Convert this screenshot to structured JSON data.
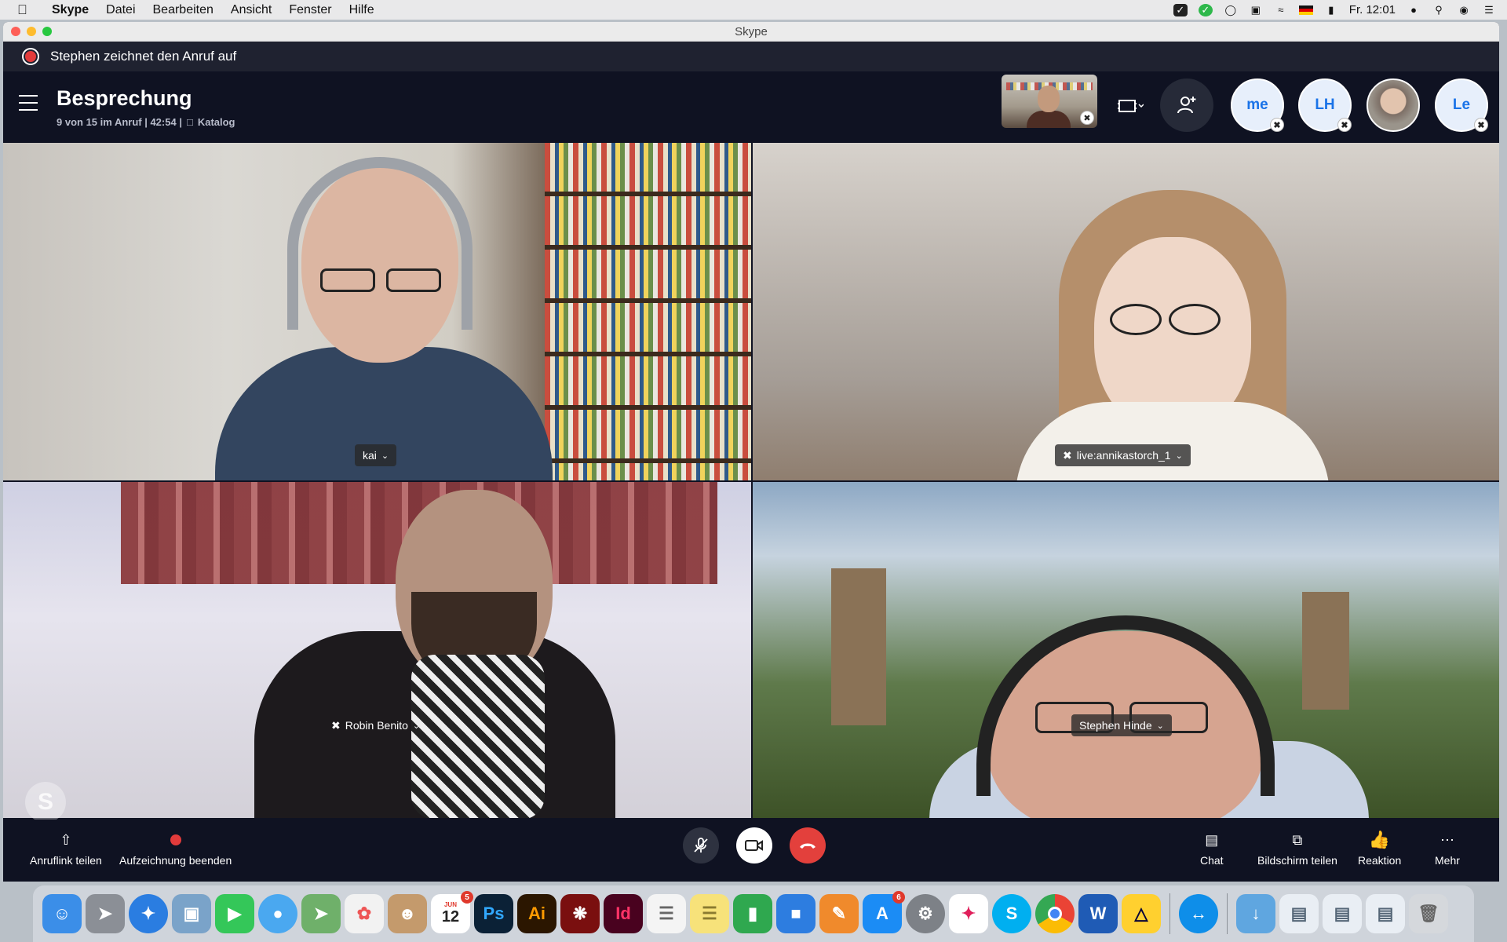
{
  "menubar": {
    "app_name": "Skype",
    "menus": [
      "Datei",
      "Bearbeiten",
      "Ansicht",
      "Fenster",
      "Hilfe"
    ],
    "clock": "Fr. 12:01"
  },
  "window": {
    "title": "Skype"
  },
  "recording_banner": {
    "text": "Stephen zeichnet den Anruf auf",
    "color": "#e23b3b"
  },
  "call_header": {
    "title": "Besprechung",
    "participants_status": "9 von 15 im Anruf | 42:54 |",
    "catalog_label": "Katalog",
    "avatars": [
      {
        "initials": "me"
      },
      {
        "initials": "LH"
      },
      {
        "initials": ""
      },
      {
        "initials": "Le"
      }
    ]
  },
  "participants": [
    {
      "name": "kai",
      "muted": false
    },
    {
      "name": "live:annikastorch_1",
      "muted": true
    },
    {
      "name": "Robin Benito",
      "muted": true
    },
    {
      "name": "Stephen Hinde",
      "muted": false
    }
  ],
  "controls": {
    "share_link": "Anruflink teilen",
    "stop_recording": "Aufzeichnung beenden",
    "chat": "Chat",
    "share_screen": "Bildschirm teilen",
    "reaction": "Reaktion",
    "more": "Mehr",
    "hangup_color": "#e3403c"
  },
  "dock": {
    "calendar_month": "JUN",
    "calendar_day": "12",
    "calendar_badge": "5",
    "appstore_badge": "6",
    "apps": [
      {
        "name": "Finder",
        "label": "",
        "color": "#3b8ee8"
      },
      {
        "name": "Launchpad",
        "label": "",
        "color": "#8b8f96"
      },
      {
        "name": "Safari",
        "label": "",
        "color": "#2a7de1"
      },
      {
        "name": "Preview",
        "label": "",
        "color": "#7aa3c9"
      },
      {
        "name": "FaceTime",
        "label": "",
        "color": "#34c759"
      },
      {
        "name": "Messages",
        "label": "",
        "color": "#4aa8f0"
      },
      {
        "name": "Maps",
        "label": "",
        "color": "#6fb06a"
      },
      {
        "name": "Photos",
        "label": "",
        "color": "#f2f2f2"
      },
      {
        "name": "Contacts",
        "label": "",
        "color": "#c49a6c"
      },
      {
        "name": "Calendar",
        "label": "",
        "color": "#ffffff"
      },
      {
        "name": "Photoshop",
        "label": "Ps",
        "color": "#0b2136"
      },
      {
        "name": "Illustrator",
        "label": "Ai",
        "color": "#2b1600"
      },
      {
        "name": "Acrobat",
        "label": "",
        "color": "#7a0f0f"
      },
      {
        "name": "InDesign",
        "label": "Id",
        "color": "#49021f"
      },
      {
        "name": "Reminders",
        "label": "",
        "color": "#f4f4f4"
      },
      {
        "name": "Notes",
        "label": "",
        "color": "#f7e27a"
      },
      {
        "name": "Numbers",
        "label": "",
        "color": "#2fa84f"
      },
      {
        "name": "Keynote",
        "label": "",
        "color": "#2d7de0"
      },
      {
        "name": "Pages",
        "label": "",
        "color": "#f08a2c"
      },
      {
        "name": "App Store",
        "label": "",
        "color": "#1b8cf5"
      },
      {
        "name": "System Preferences",
        "label": "",
        "color": "#7d8187"
      },
      {
        "name": "Slack",
        "label": "",
        "color": "#ffffff"
      },
      {
        "name": "Skype",
        "label": "S",
        "color": "#00aff0"
      },
      {
        "name": "Chrome",
        "label": "",
        "color": "#ffffff"
      },
      {
        "name": "Word",
        "label": "W",
        "color": "#1f5bb5"
      },
      {
        "name": "Miro",
        "label": "",
        "color": "#ffd02f"
      }
    ],
    "right_apps": [
      {
        "name": "TeamViewer",
        "color": "#0e8ee9"
      },
      {
        "name": "Downloads",
        "color": "#5fa6e0"
      },
      {
        "name": "Window 1",
        "color": "#e9eef4"
      },
      {
        "name": "Window 2",
        "color": "#e9eef4"
      },
      {
        "name": "Window 3",
        "color": "#e9eef4"
      },
      {
        "name": "Trash",
        "color": "#d5d8dc"
      }
    ]
  }
}
